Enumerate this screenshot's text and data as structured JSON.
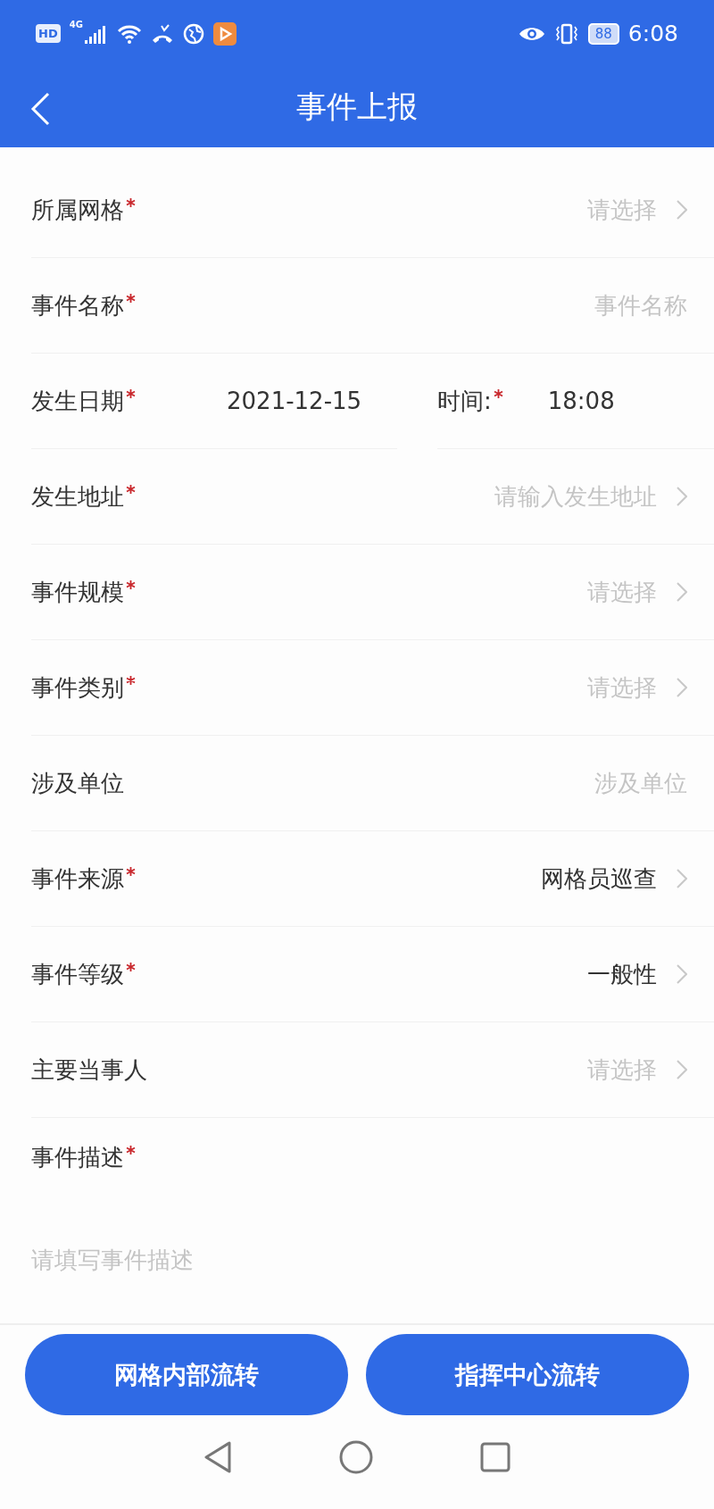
{
  "status_bar": {
    "hd": "HD",
    "network": "4G",
    "battery": "88",
    "time": "6:08"
  },
  "header": {
    "title": "事件上报"
  },
  "rows": [
    {
      "kind": "select",
      "label": "所属网格",
      "required": true,
      "placeholder": "请选择"
    },
    {
      "kind": "input",
      "label": "事件名称",
      "required": true,
      "placeholder": "事件名称"
    },
    {
      "kind": "datetime",
      "label": "发生日期",
      "required": true,
      "value": "2021-12-15",
      "time_label": "时间:",
      "time_required": true,
      "time_value": "18:08"
    },
    {
      "kind": "select",
      "label": "发生地址",
      "required": true,
      "placeholder": "请输入发生地址"
    },
    {
      "kind": "select",
      "label": "事件规模",
      "required": true,
      "placeholder": "请选择"
    },
    {
      "kind": "select",
      "label": "事件类别",
      "required": true,
      "placeholder": "请选择"
    },
    {
      "kind": "input",
      "label": "涉及单位",
      "required": false,
      "placeholder": "涉及单位"
    },
    {
      "kind": "select",
      "label": "事件来源",
      "required": true,
      "value": "网格员巡查"
    },
    {
      "kind": "select",
      "label": "事件等级",
      "required": true,
      "value": "一般性"
    },
    {
      "kind": "select",
      "label": "主要当事人",
      "required": false,
      "placeholder": "请选择"
    }
  ],
  "description": {
    "label": "事件描述",
    "required": true,
    "placeholder": "请填写事件描述"
  },
  "buttons": [
    {
      "label": "网格内部流转"
    },
    {
      "label": "指挥中心流转"
    }
  ]
}
